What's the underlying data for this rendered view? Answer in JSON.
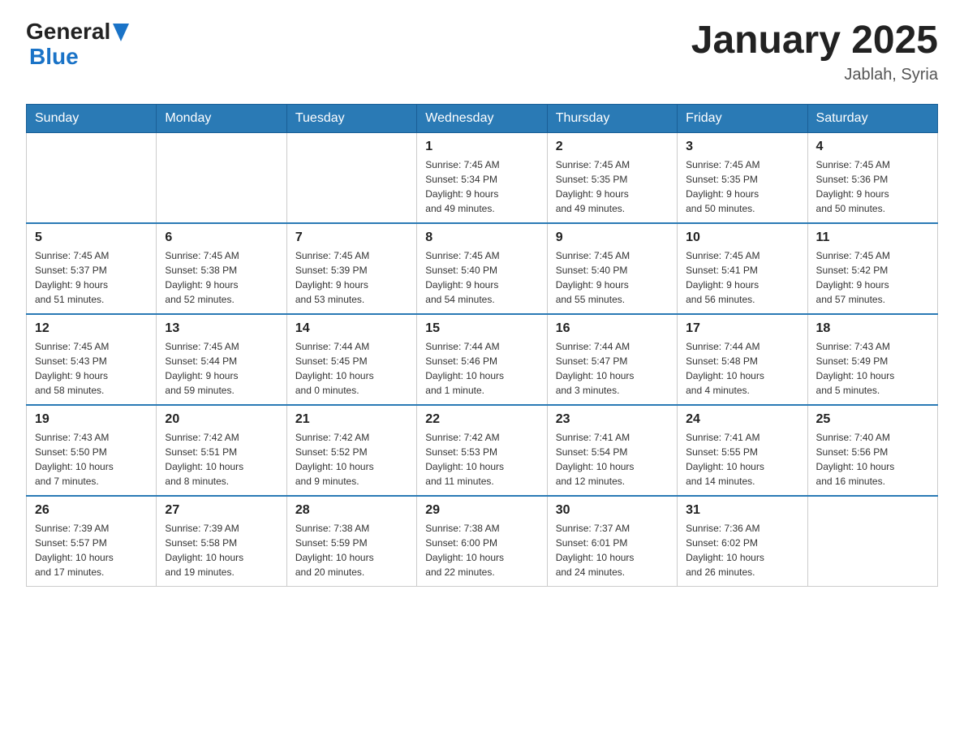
{
  "header": {
    "logo_general": "General",
    "logo_blue": "Blue",
    "title": "January 2025",
    "location": "Jablah, Syria"
  },
  "days_of_week": [
    "Sunday",
    "Monday",
    "Tuesday",
    "Wednesday",
    "Thursday",
    "Friday",
    "Saturday"
  ],
  "weeks": [
    [
      {
        "day": "",
        "info": ""
      },
      {
        "day": "",
        "info": ""
      },
      {
        "day": "",
        "info": ""
      },
      {
        "day": "1",
        "info": "Sunrise: 7:45 AM\nSunset: 5:34 PM\nDaylight: 9 hours\nand 49 minutes."
      },
      {
        "day": "2",
        "info": "Sunrise: 7:45 AM\nSunset: 5:35 PM\nDaylight: 9 hours\nand 49 minutes."
      },
      {
        "day": "3",
        "info": "Sunrise: 7:45 AM\nSunset: 5:35 PM\nDaylight: 9 hours\nand 50 minutes."
      },
      {
        "day": "4",
        "info": "Sunrise: 7:45 AM\nSunset: 5:36 PM\nDaylight: 9 hours\nand 50 minutes."
      }
    ],
    [
      {
        "day": "5",
        "info": "Sunrise: 7:45 AM\nSunset: 5:37 PM\nDaylight: 9 hours\nand 51 minutes."
      },
      {
        "day": "6",
        "info": "Sunrise: 7:45 AM\nSunset: 5:38 PM\nDaylight: 9 hours\nand 52 minutes."
      },
      {
        "day": "7",
        "info": "Sunrise: 7:45 AM\nSunset: 5:39 PM\nDaylight: 9 hours\nand 53 minutes."
      },
      {
        "day": "8",
        "info": "Sunrise: 7:45 AM\nSunset: 5:40 PM\nDaylight: 9 hours\nand 54 minutes."
      },
      {
        "day": "9",
        "info": "Sunrise: 7:45 AM\nSunset: 5:40 PM\nDaylight: 9 hours\nand 55 minutes."
      },
      {
        "day": "10",
        "info": "Sunrise: 7:45 AM\nSunset: 5:41 PM\nDaylight: 9 hours\nand 56 minutes."
      },
      {
        "day": "11",
        "info": "Sunrise: 7:45 AM\nSunset: 5:42 PM\nDaylight: 9 hours\nand 57 minutes."
      }
    ],
    [
      {
        "day": "12",
        "info": "Sunrise: 7:45 AM\nSunset: 5:43 PM\nDaylight: 9 hours\nand 58 minutes."
      },
      {
        "day": "13",
        "info": "Sunrise: 7:45 AM\nSunset: 5:44 PM\nDaylight: 9 hours\nand 59 minutes."
      },
      {
        "day": "14",
        "info": "Sunrise: 7:44 AM\nSunset: 5:45 PM\nDaylight: 10 hours\nand 0 minutes."
      },
      {
        "day": "15",
        "info": "Sunrise: 7:44 AM\nSunset: 5:46 PM\nDaylight: 10 hours\nand 1 minute."
      },
      {
        "day": "16",
        "info": "Sunrise: 7:44 AM\nSunset: 5:47 PM\nDaylight: 10 hours\nand 3 minutes."
      },
      {
        "day": "17",
        "info": "Sunrise: 7:44 AM\nSunset: 5:48 PM\nDaylight: 10 hours\nand 4 minutes."
      },
      {
        "day": "18",
        "info": "Sunrise: 7:43 AM\nSunset: 5:49 PM\nDaylight: 10 hours\nand 5 minutes."
      }
    ],
    [
      {
        "day": "19",
        "info": "Sunrise: 7:43 AM\nSunset: 5:50 PM\nDaylight: 10 hours\nand 7 minutes."
      },
      {
        "day": "20",
        "info": "Sunrise: 7:42 AM\nSunset: 5:51 PM\nDaylight: 10 hours\nand 8 minutes."
      },
      {
        "day": "21",
        "info": "Sunrise: 7:42 AM\nSunset: 5:52 PM\nDaylight: 10 hours\nand 9 minutes."
      },
      {
        "day": "22",
        "info": "Sunrise: 7:42 AM\nSunset: 5:53 PM\nDaylight: 10 hours\nand 11 minutes."
      },
      {
        "day": "23",
        "info": "Sunrise: 7:41 AM\nSunset: 5:54 PM\nDaylight: 10 hours\nand 12 minutes."
      },
      {
        "day": "24",
        "info": "Sunrise: 7:41 AM\nSunset: 5:55 PM\nDaylight: 10 hours\nand 14 minutes."
      },
      {
        "day": "25",
        "info": "Sunrise: 7:40 AM\nSunset: 5:56 PM\nDaylight: 10 hours\nand 16 minutes."
      }
    ],
    [
      {
        "day": "26",
        "info": "Sunrise: 7:39 AM\nSunset: 5:57 PM\nDaylight: 10 hours\nand 17 minutes."
      },
      {
        "day": "27",
        "info": "Sunrise: 7:39 AM\nSunset: 5:58 PM\nDaylight: 10 hours\nand 19 minutes."
      },
      {
        "day": "28",
        "info": "Sunrise: 7:38 AM\nSunset: 5:59 PM\nDaylight: 10 hours\nand 20 minutes."
      },
      {
        "day": "29",
        "info": "Sunrise: 7:38 AM\nSunset: 6:00 PM\nDaylight: 10 hours\nand 22 minutes."
      },
      {
        "day": "30",
        "info": "Sunrise: 7:37 AM\nSunset: 6:01 PM\nDaylight: 10 hours\nand 24 minutes."
      },
      {
        "day": "31",
        "info": "Sunrise: 7:36 AM\nSunset: 6:02 PM\nDaylight: 10 hours\nand 26 minutes."
      },
      {
        "day": "",
        "info": ""
      }
    ]
  ]
}
